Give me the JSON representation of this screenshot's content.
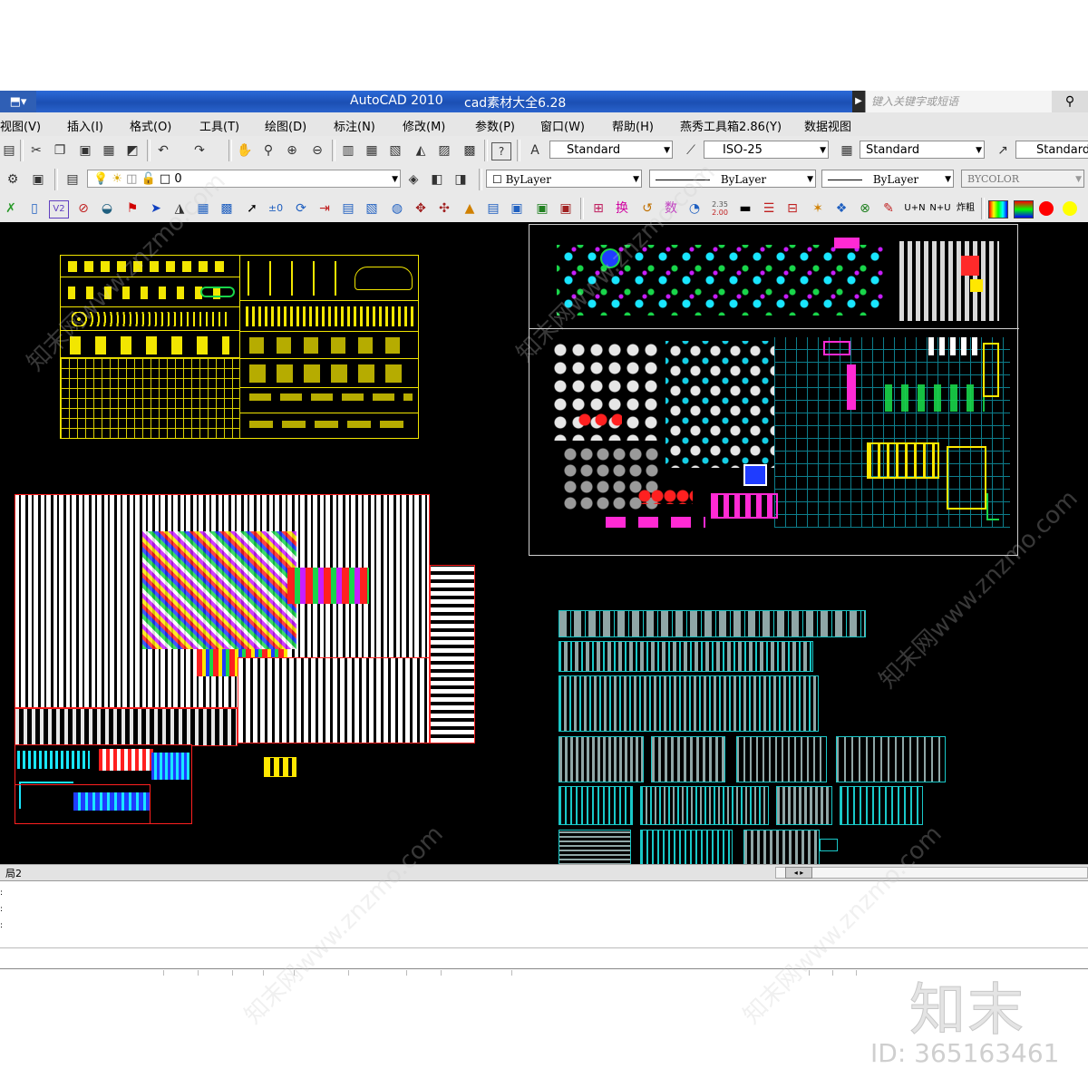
{
  "window": {
    "app_title": "AutoCAD 2010",
    "document_name": "cad素材大全6.28",
    "search_placeholder": "键入关键字或短语"
  },
  "menus": [
    "视图(V)",
    "插入(I)",
    "格式(O)",
    "工具(T)",
    "绘图(D)",
    "标注(N)",
    "修改(M)",
    "参数(P)",
    "窗口(W)",
    "帮助(H)",
    "燕秀工具箱2.86(Y)",
    "数据视图"
  ],
  "toolbar_standard": {
    "text_style": "Standard",
    "dim_style": "ISO-25",
    "table_style": "Standard",
    "multileader_style": "Standard"
  },
  "toolbar_layers": {
    "current_layer": "0",
    "color": "ByLayer",
    "linetype": "ByLayer",
    "lineweight": "ByLayer",
    "plot_style": "BYCOLOR"
  },
  "toolbar_express": {
    "labels": [
      "换",
      "数",
      "2.35",
      "2.00",
      "U+N",
      "N+U",
      "炸粗"
    ],
    "colors": [
      "#ff0000",
      "#ffff00"
    ]
  },
  "layout_tab": "局2",
  "watermark": {
    "logo": "知末",
    "id": "ID: 365163461",
    "site": "知末网www.znzmo.com"
  }
}
